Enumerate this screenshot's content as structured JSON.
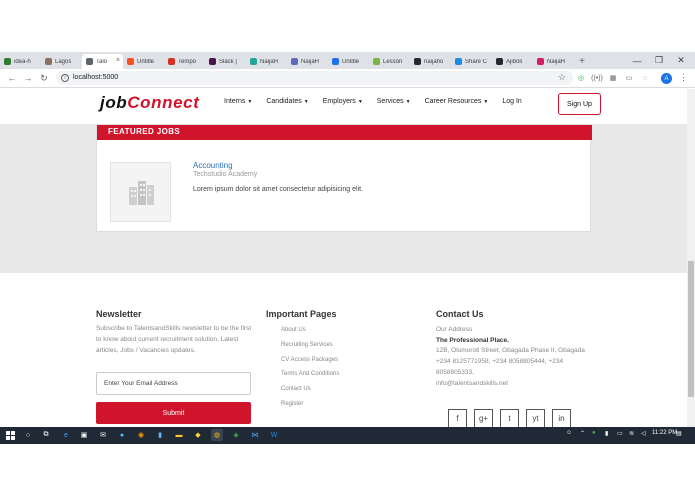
{
  "browser": {
    "tabs": [
      {
        "label": "idea-h",
        "color": "#2e7d32",
        "active": false
      },
      {
        "label": "Lagos",
        "color": "#8d6e63",
        "active": false
      },
      {
        "label": "Talo",
        "color": "#5f6368",
        "active": true
      },
      {
        "label": "Untitle",
        "color": "#f4511e",
        "active": false
      },
      {
        "label": "Tempo",
        "color": "#d93025",
        "active": false
      },
      {
        "label": "Slack |",
        "color": "#4a154b",
        "active": false
      },
      {
        "label": "NaijaH",
        "color": "#26a69a",
        "active": false
      },
      {
        "label": "NaijaH",
        "color": "#5c6bc0",
        "active": false
      },
      {
        "label": "Untitle",
        "color": "#1a73e8",
        "active": false
      },
      {
        "label": "Lesson",
        "color": "#7cb342",
        "active": false
      },
      {
        "label": "naijaho",
        "color": "#24292e",
        "active": false
      },
      {
        "label": "Share C",
        "color": "#1e88e5",
        "active": false
      },
      {
        "label": "Ajiboli",
        "color": "#24292e",
        "active": false
      },
      {
        "label": "NaijaH",
        "color": "#d81b60",
        "active": false
      }
    ],
    "new_tab_glyph": "+",
    "close_glyph": "×",
    "window_controls": {
      "minimize": "—",
      "restore": "❐",
      "close": "✕"
    },
    "url": "localhost:5000",
    "avatar_letter": "A"
  },
  "site": {
    "logo_job": "job",
    "logo_connect": "Connect",
    "nav": [
      {
        "label": "Interns",
        "dropdown": true
      },
      {
        "label": "Candidates",
        "dropdown": true
      },
      {
        "label": "Employers",
        "dropdown": true
      },
      {
        "label": "Services",
        "dropdown": true
      },
      {
        "label": "Career Resources",
        "dropdown": true
      },
      {
        "label": "Log In",
        "dropdown": false
      }
    ],
    "caret": "▼",
    "signup": "Sign Up",
    "accent": "#d0142c"
  },
  "featured": {
    "header": "FEATURED JOBS",
    "job_title": "Accounting",
    "job_company": "Techstudio Academy",
    "job_desc": "Lorem ipsum dolor sit amet consectetur adipisicing elit."
  },
  "footer": {
    "newsletter_title": "Newsletter",
    "newsletter_text": "Subscribe to TalentsandSkills newsletter to be the first to know about current recruitment solution, Latest articles, Jobs / Vacancies updates.",
    "email_placeholder": "Enter Your Email Address",
    "submit": "Submit",
    "pages_title": "Important Pages",
    "pages": [
      "About Us",
      "Recruiting Services",
      "CV Access Packages",
      "Terms And Conditions",
      "Contact Us",
      "Register"
    ],
    "contact_title": "Contact Us",
    "address_label": "Our Address",
    "address_name": "The Professional Place.",
    "address_line": "12B, Olumoroti Street, Gbagada Phase II, Gbagada",
    "phones": "+234 8125771958, +234 8058805444, +234 8058805333,",
    "email": "info@talentsandskills.net",
    "social": [
      "f",
      "g+",
      "t",
      "yt",
      "in"
    ]
  },
  "taskbar": {
    "time": "11:22 PM"
  }
}
